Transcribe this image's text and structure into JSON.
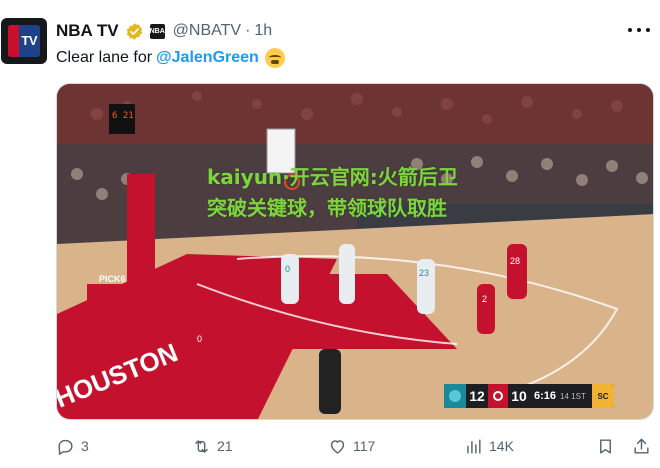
{
  "tweet": {
    "display_name": "NBA TV",
    "handle": "@NBATV",
    "separator": "·",
    "time": "1h",
    "avatar_icon": "nba-tv-logo",
    "verified_icon": "gold-verified-checkmark",
    "affiliate_badge": "nba-affiliate-badge",
    "text_prefix": "Clear lane for",
    "mention": "@JalenGreen",
    "emoji": "steaming-face-emoji"
  },
  "media": {
    "watermark": "kaiyun·开云官网:火箭后卫突破关键球，带领球队取胜",
    "scorebug": {
      "away_score": "12",
      "home_score": "10",
      "clock": "6:16",
      "period": "14 1ST",
      "network": "SC"
    },
    "arena_text": {
      "baseline": "HOUSTON",
      "stanchion": "PICK6",
      "shot_clock": "6 21"
    },
    "players": {
      "jersey_1": "0",
      "jersey_2": "23",
      "jersey_3": "28",
      "jersey_4": "2",
      "jersey_5": "0"
    }
  },
  "actions": {
    "reply_count": "3",
    "repost_count": "21",
    "like_count": "117",
    "view_count": "14K"
  },
  "colors": {
    "mention": "#1d9bf0",
    "watermark": "#7cd63b",
    "rockets_red": "#c4122e",
    "hornets_teal": "#1a8a9a"
  }
}
